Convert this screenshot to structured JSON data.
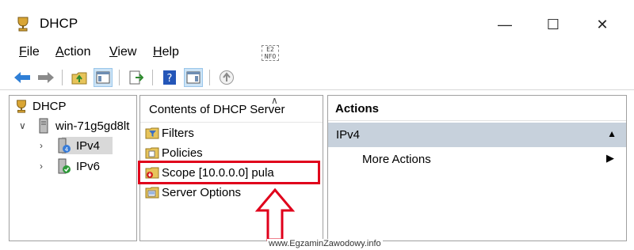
{
  "window": {
    "title": "DHCP",
    "controls": {
      "minimize": "—",
      "maximize": "☐",
      "close": "✕"
    }
  },
  "menu": {
    "file": {
      "accel": "F",
      "rest": "ile"
    },
    "action": {
      "accel": "A",
      "rest": "ction"
    },
    "view": {
      "accel": "V",
      "rest": "iew"
    },
    "help": {
      "accel": "H",
      "rest": "elp"
    }
  },
  "toolbar": {
    "buttons": [
      "back-icon",
      "forward-icon",
      "up-folder-icon",
      "show-hide-console-tree-icon",
      "export-list-icon",
      "help-icon",
      "show-hide-action-pane-icon",
      "up-level-icon"
    ]
  },
  "tree": {
    "root": "DHCP",
    "server": "win-71g5gd8lt",
    "ipv4": "IPv4",
    "ipv6": "IPv6"
  },
  "contents": {
    "title": "Contents of DHCP Server",
    "items": [
      "Filters",
      "Policies",
      "Scope [10.0.0.0] pula",
      "Server Options"
    ]
  },
  "actions": {
    "title": "Actions",
    "section": "IPv4",
    "more": "More Actions"
  },
  "watermark": "www.EgzaminZawodowy.info",
  "colors": {
    "highlight": "#e0001b",
    "section_bg": "#c7d1dc",
    "selection_bg": "#d9d9d9"
  }
}
